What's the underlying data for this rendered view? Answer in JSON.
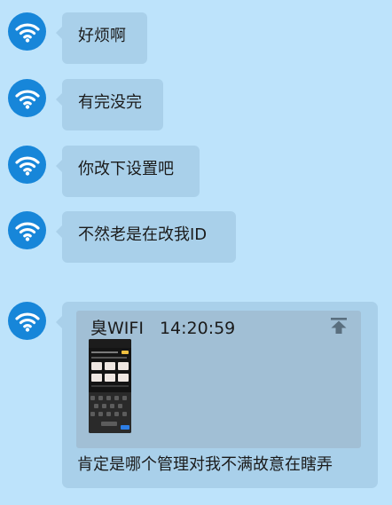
{
  "messages": [
    {
      "sender_icon": "wifi-icon",
      "text": "好烦啊"
    },
    {
      "sender_icon": "wifi-icon",
      "text": "有完没完"
    },
    {
      "sender_icon": "wifi-icon",
      "text": "你改下设置吧"
    },
    {
      "sender_icon": "wifi-icon",
      "text": "不然老是在改我ID"
    }
  ],
  "quote_card": {
    "sender_icon": "wifi-icon",
    "quoted_name": "臭WIFI",
    "quoted_time": "14:20:59",
    "pin_icon": "pin-to-top-icon",
    "quoted_image": "phone-screenshot-thumbnail",
    "caption": "肯定是哪个管理对我不满故意在瞎弄"
  },
  "colors": {
    "background": "#bde3fb",
    "bubble": "#a9d0ea",
    "avatar": "#1786d9"
  }
}
